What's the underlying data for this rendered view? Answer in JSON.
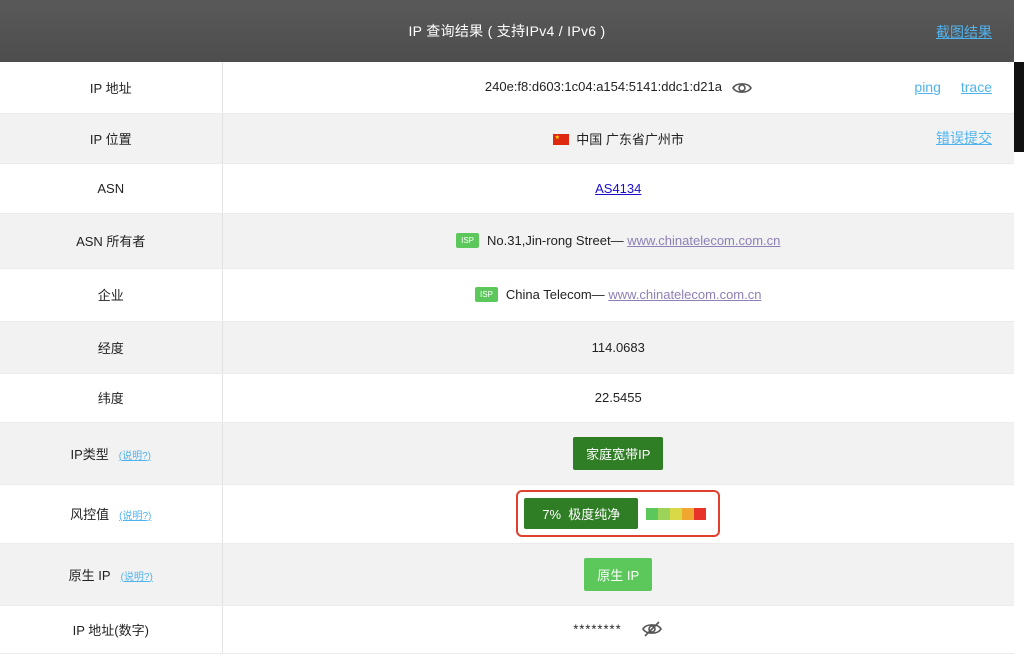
{
  "header": {
    "title": "IP 查询结果 ( 支持IPv4 / IPv6 )",
    "screenshot_link": "截图结果"
  },
  "rows": {
    "ip": {
      "label": "IP 地址",
      "value": "240e:f8:d603:1c04:a154:5141:ddc1:d21a",
      "ping": "ping",
      "trace": "trace"
    },
    "location": {
      "label": "IP 位置",
      "value": "中国 广东省广州市",
      "report": "错误提交"
    },
    "asn": {
      "label": "ASN",
      "value": "AS4134"
    },
    "owner": {
      "label": "ASN 所有者",
      "badge": "ISP",
      "text": "No.31,Jin-rong Street—",
      "link": "www.chinatelecom.com.cn"
    },
    "enterprise": {
      "label": "企业",
      "badge": "ISP",
      "text": "China Telecom—",
      "link": "www.chinatelecom.com.cn"
    },
    "longitude": {
      "label": "经度",
      "value": "114.0683"
    },
    "latitude": {
      "label": "纬度",
      "value": "22.5455"
    },
    "ip_type": {
      "label": "IP类型",
      "note": "(说明?)",
      "value": "家庭宽带IP"
    },
    "risk": {
      "label": "风控值",
      "note": "(说明?)",
      "value": "7%  极度纯净",
      "scale_colors": [
        "#5cc85c",
        "#9ed35a",
        "#d9d948",
        "#f0a732",
        "#e8332a"
      ]
    },
    "native": {
      "label": "原生 IP",
      "note": "(说明?)",
      "value": "原生 IP"
    },
    "numeric": {
      "label": "IP 地址(数字)",
      "value": "********"
    }
  },
  "icons": {
    "eye": "eye-icon",
    "eye_off": "eye-off-icon",
    "flag": "china-flag-icon"
  },
  "colors": {
    "header_bg": "#555555",
    "link": "#4fb3f0",
    "badge_dark_green": "#2f7d24",
    "badge_light_green": "#5cc85c",
    "highlight_border": "#e0412f"
  }
}
